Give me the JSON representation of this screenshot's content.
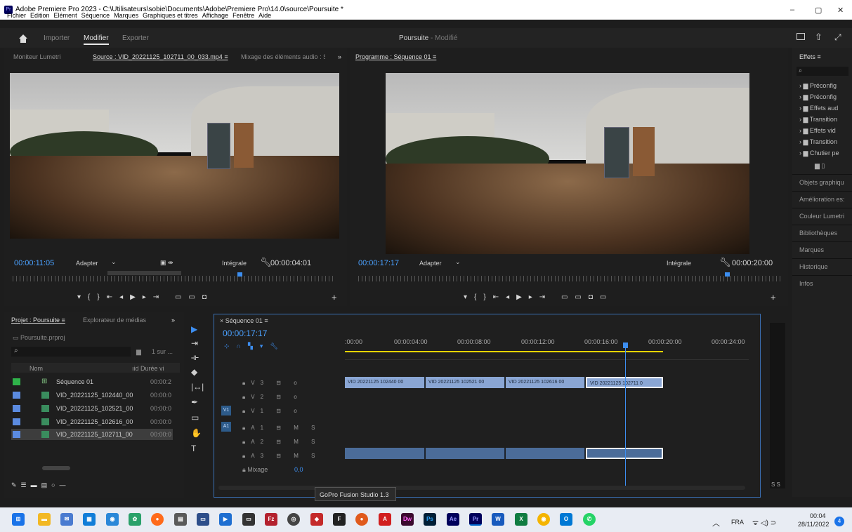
{
  "window": {
    "title": "Adobe Premiere Pro 2023 - C:\\Utilisateurs\\sobie\\Documents\\Adobe\\Premiere Pro\\14.0\\source\\Poursuite *",
    "menu": [
      "Fichier",
      "Edition",
      "Elément",
      "Séquence",
      "Marques",
      "Graphiques et titres",
      "Affichage",
      "Fenêtre",
      "Aide"
    ],
    "controls": [
      "–",
      "▢",
      "✕"
    ]
  },
  "workspace": {
    "tabs": [
      "Importer",
      "Modifier",
      "Exporter"
    ],
    "project": "Poursuite",
    "status": "- Modifié"
  },
  "source": {
    "tabs": [
      "Moniteur Lumetri",
      "Source : VID_20221125_102711_00_033.mp4 ≡",
      "Mixage des éléments audio : S",
      "»"
    ],
    "timecode": "00:00:11:05",
    "fit": "Adapter",
    "quality": "Intégrale",
    "duration": "00:00:04:01"
  },
  "program": {
    "tab": "Programme : Séquence 01 ≡",
    "timecode": "00:00:17:17",
    "fit": "Adapter",
    "quality": "Intégrale",
    "duration": "00:00:20:00"
  },
  "project": {
    "tabs": [
      "Projet : Poursuite ≡",
      "Explorateur de médias",
      "»"
    ],
    "file": "Poursuite.prproj",
    "count": "1 sur ...",
    "col_name": "Nom",
    "col_dur": "ıid Durée vi",
    "rows": [
      {
        "name": "Séquence 01",
        "dur": "00:00:2",
        "color": "#2fb34a"
      },
      {
        "name": "VID_20221125_102440_00",
        "dur": "00:00:0",
        "color": "#5b8be0"
      },
      {
        "name": "VID_20221125_102521_00",
        "dur": "00:00:0",
        "color": "#5b8be0"
      },
      {
        "name": "VID_20221125_102616_00",
        "dur": "00:00:0",
        "color": "#5b8be0"
      },
      {
        "name": "VID_20221125_102711_00",
        "dur": "00:00:0",
        "color": "#5b8be0"
      }
    ]
  },
  "timeline": {
    "tab": "Séquence 01 ≡",
    "close": "×",
    "timecode": "00:00:17:17",
    "ticks": [
      ":00:00",
      "00:00:04:00",
      "00:00:08:00",
      "00:00:12:00",
      "00:00:16:00",
      "00:00:20:00",
      "00:00:24:00"
    ],
    "tracks": [
      "V3",
      "V2",
      "V1",
      "A1",
      "A2",
      "A3"
    ],
    "mix_label": "Mixage",
    "mix_value": "0,0",
    "clips": [
      "VID 20221125 102440 00",
      "VID 20221125 102521 00",
      "VID 20221125 102616 00",
      "VID 20221125 102711 0"
    ],
    "meter": "S S"
  },
  "effects": {
    "tab": "Effets ≡",
    "items": [
      "Préconfig",
      "Préconfig",
      "Effets aud",
      "Transition",
      "Effets vid",
      "Transition",
      "Chutier pe"
    ],
    "sections": [
      "Objets graphiqu",
      "Amélioration es:",
      "Couleur Lumetri",
      "Bibliothèques",
      "Marques",
      "Historique",
      "Infos"
    ]
  },
  "tooltip": "GoPro Fusion Studio 1.3",
  "taskbar": {
    "lang": "FRA",
    "time": "00:04",
    "date": "28/11/2022",
    "badge": "4",
    "apps": [
      "win",
      "files",
      "mail",
      "store",
      "cam",
      "pics",
      "ff",
      "calc",
      "hw",
      "sw",
      "edge",
      "fz",
      "obs",
      "vr",
      "fl",
      "chrome",
      "acro",
      "Dw",
      "Ps",
      "Ae",
      "Pr",
      "W",
      "X",
      "chr",
      "ol",
      "wa"
    ]
  }
}
